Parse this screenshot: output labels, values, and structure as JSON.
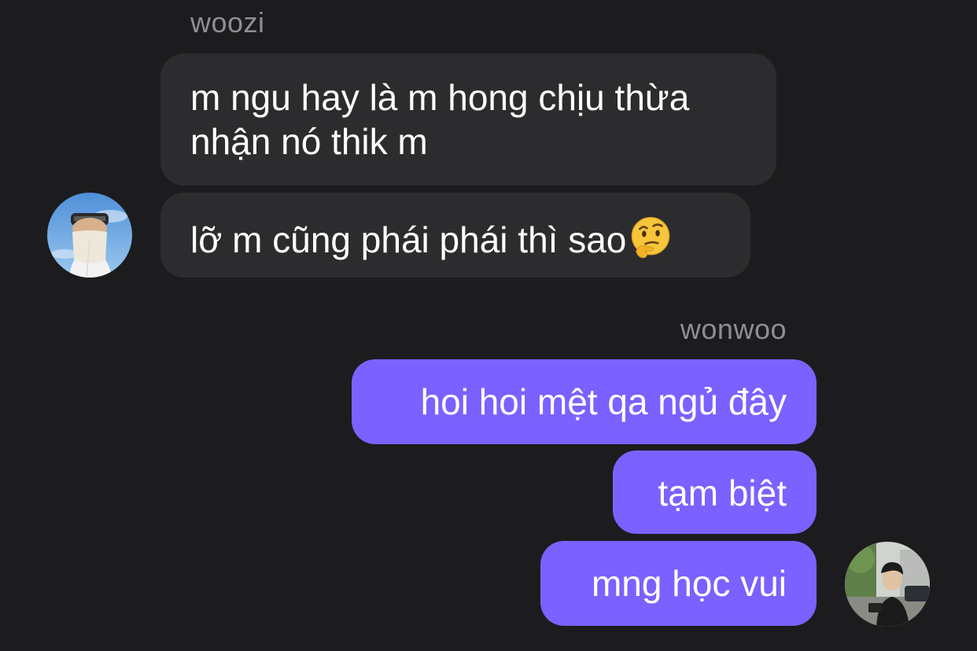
{
  "thread": {
    "incoming": {
      "sender": "woozi",
      "messages": [
        "m ngu hay là m hong chịu thừa nhận nó thik m",
        "lỡ m cũng phái phái thì sao"
      ],
      "emoji": "thinking-face"
    },
    "outgoing": {
      "sender": "wonwoo",
      "messages": [
        "hoi hoi mệt qa ngủ đây",
        "tạm biệt",
        "mng học vui"
      ]
    }
  },
  "colors": {
    "background": "#1c1c1e",
    "incoming_bubble": "#2c2c2e",
    "outgoing_bubble": "#7b61ff",
    "sender_name": "#8e8e93",
    "text": "#ffffff"
  }
}
